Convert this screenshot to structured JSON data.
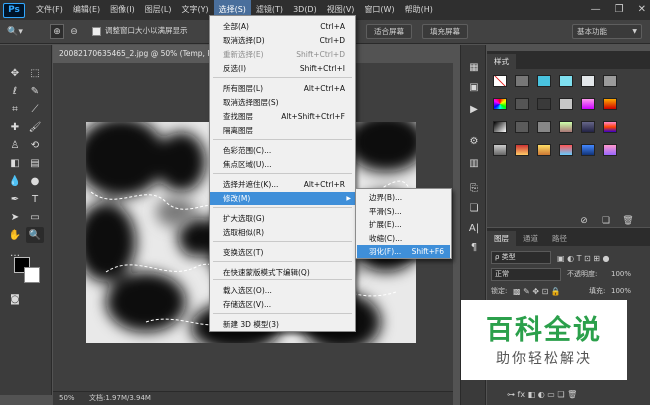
{
  "app": {
    "logo": "Ps"
  },
  "menubar": {
    "items": [
      "文件(F)",
      "编辑(E)",
      "图像(I)",
      "图层(L)",
      "文字(Y)",
      "选择(S)",
      "滤镜(T)",
      "3D(D)",
      "视图(V)",
      "窗口(W)",
      "帮助(H)"
    ],
    "active_index": 5
  },
  "window_controls": {
    "minimize": "—",
    "restore": "❐",
    "close": "✕"
  },
  "options_bar": {
    "checkbox_label": "调整窗口大小以满屏显示",
    "fit_screen": "适合屏幕",
    "fill_screen": "填充屏幕",
    "workspace": "基本功能"
  },
  "document": {
    "tab_title": "20082170635465_2.jpg @ 50% (Temp, RGB/8)"
  },
  "status_bar": {
    "zoom": "50%",
    "doc_info": "文档:1.97M/3.94M"
  },
  "select_menu": {
    "items": [
      {
        "label": "全部(A)",
        "shortcut": "Ctrl+A",
        "disabled": false
      },
      {
        "label": "取消选择(D)",
        "shortcut": "Ctrl+D",
        "disabled": false
      },
      {
        "label": "重新选择(E)",
        "shortcut": "Shift+Ctrl+D",
        "disabled": true
      },
      {
        "label": "反选(I)",
        "shortcut": "Shift+Ctrl+I",
        "disabled": false
      },
      {
        "label": "所有图层(L)",
        "shortcut": "Alt+Ctrl+A",
        "disabled": false
      },
      {
        "label": "取消选择图层(S)",
        "shortcut": "",
        "disabled": false
      },
      {
        "label": "查找图层",
        "shortcut": "Alt+Shift+Ctrl+F",
        "disabled": false
      },
      {
        "label": "隔离图层",
        "shortcut": "",
        "disabled": false
      },
      {
        "label": "色彩范围(C)...",
        "shortcut": "",
        "disabled": false
      },
      {
        "label": "焦点区域(U)...",
        "shortcut": "",
        "disabled": false
      },
      {
        "label": "选择并遮住(K)...",
        "shortcut": "Alt+Ctrl+R",
        "disabled": false
      },
      {
        "label": "修改(M)",
        "shortcut": "",
        "disabled": false
      },
      {
        "label": "扩大选取(G)",
        "shortcut": "",
        "disabled": false
      },
      {
        "label": "选取相似(R)",
        "shortcut": "",
        "disabled": false
      },
      {
        "label": "变换选区(T)",
        "shortcut": "",
        "disabled": false
      },
      {
        "label": "在快速蒙版模式下编辑(Q)",
        "shortcut": "",
        "disabled": false
      },
      {
        "label": "载入选区(O)...",
        "shortcut": "",
        "disabled": false
      },
      {
        "label": "存储选区(V)...",
        "shortcut": "",
        "disabled": false
      },
      {
        "label": "新建 3D 模型(3)",
        "shortcut": "",
        "disabled": false
      }
    ],
    "highlighted_index": 11
  },
  "modify_menu": {
    "items": [
      {
        "label": "边界(B)...",
        "shortcut": ""
      },
      {
        "label": "平滑(S)...",
        "shortcut": ""
      },
      {
        "label": "扩展(E)...",
        "shortcut": ""
      },
      {
        "label": "收缩(C)...",
        "shortcut": ""
      },
      {
        "label": "羽化(F)...",
        "shortcut": "Shift+F6"
      }
    ],
    "highlighted_index": 4
  },
  "styles_panel": {
    "tab": "样式"
  },
  "layers_panel": {
    "tabs": [
      "图层",
      "通道",
      "路径"
    ],
    "filter_kind": "类型",
    "blend_mode": "正常",
    "opacity_label": "不透明度:",
    "opacity_value": "100%",
    "lock_label": "锁定:",
    "fill_label": "填充:",
    "fill_value": "100%"
  },
  "watermark": {
    "title": "百科全说",
    "subtitle": "助你轻松解决"
  },
  "colors": {
    "menu_highlight": "#3f8fd9",
    "watermark_green": "#2ba04b"
  }
}
